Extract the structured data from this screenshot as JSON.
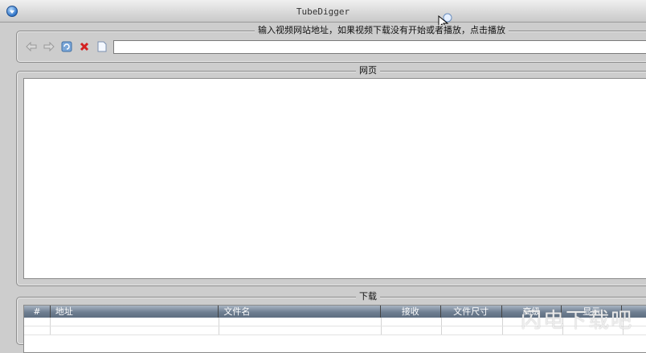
{
  "window": {
    "title": "TubeDigger"
  },
  "address_group": {
    "legend": "输入视频网站地址，如果视频下载没有开始或者播放，点击播放",
    "url_value": ""
  },
  "web_group": {
    "legend": "网页"
  },
  "download_group": {
    "legend": "下载",
    "columns": [
      "#",
      "地址",
      "文件名",
      "接收",
      "文件尺寸",
      "高级",
      "显示",
      ""
    ]
  },
  "watermark": "闪电下载吧",
  "icons": {
    "app": "download-arrow-icon",
    "back": "back-arrow-icon",
    "forward": "forward-arrow-icon",
    "refresh": "refresh-icon",
    "stop": "stop-icon",
    "page": "blank-page-icon",
    "go": "go-icon"
  },
  "colors": {
    "stop": "#d42020",
    "header": "#6e7e91",
    "accent": "#2e73c7"
  }
}
